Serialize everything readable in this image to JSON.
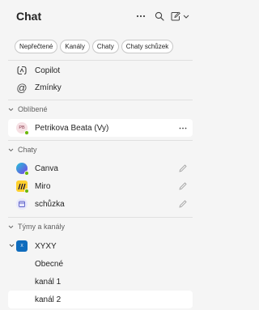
{
  "header": {
    "title": "Chat",
    "more_icon": "more-horizontal-icon",
    "search_icon": "search-icon",
    "new_chat_icon": "compose-icon"
  },
  "filters": [
    "Nepřečtené",
    "Kanály",
    "Chaty",
    "Chaty schůzek"
  ],
  "quick_links": [
    {
      "label": "Copilot",
      "icon": "copilot-icon"
    },
    {
      "label": "Zmínky",
      "icon": "at-mention-icon"
    }
  ],
  "favorites": {
    "section_label": "Oblíbené",
    "items": [
      {
        "label": "Petrikova Beata (Vy)",
        "initials": "PB",
        "status_color": "#6bb700"
      }
    ]
  },
  "chats": {
    "section_label": "Chaty",
    "items": [
      {
        "label": "Canva",
        "icon": "canva-app-icon"
      },
      {
        "label": "Miro",
        "icon": "miro-app-icon"
      },
      {
        "label": "schůzka",
        "icon": "meeting-icon"
      }
    ]
  },
  "teams": {
    "section_label": "Týmy a kanály",
    "team": {
      "label": "XYXY",
      "initials": "X"
    },
    "channels": [
      {
        "label": "Obecné"
      },
      {
        "label": "kanál 1"
      },
      {
        "label": "kanál 2"
      }
    ]
  },
  "colors": {
    "accent": "#5b5fc7",
    "presence": "#6bb700",
    "team_badge": "#0f6cbd"
  }
}
